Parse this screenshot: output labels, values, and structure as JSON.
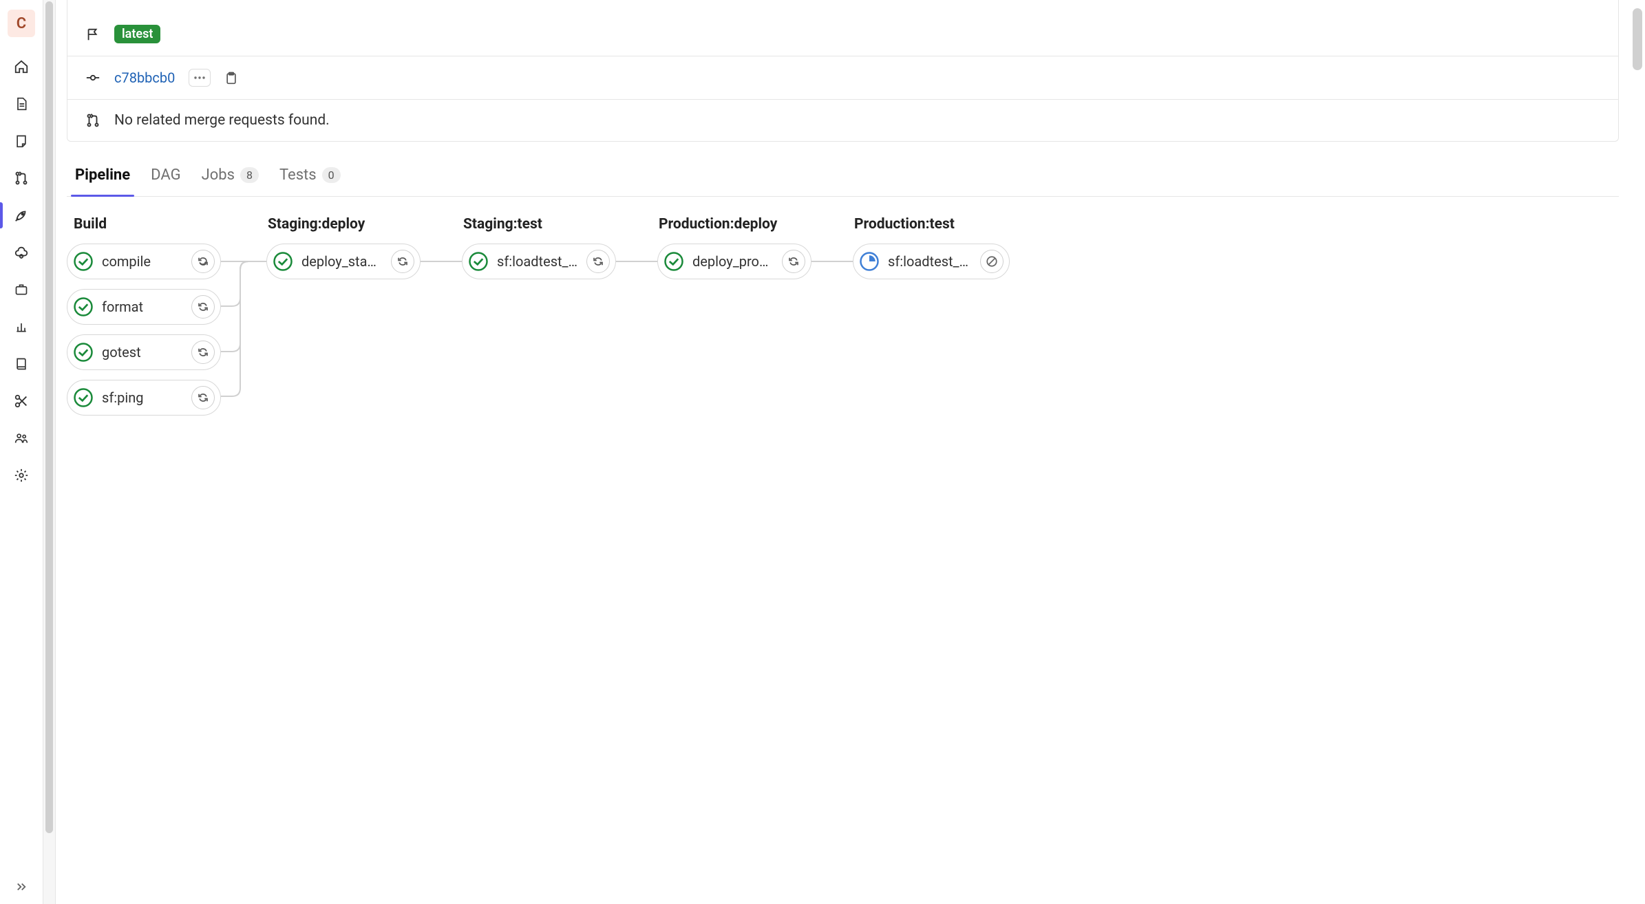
{
  "sidebar": {
    "avatar_letter": "C"
  },
  "header": {
    "badge": "latest",
    "commit_sha": "c78bbcb0",
    "mr_text": "No related merge requests found."
  },
  "tabs": {
    "pipeline": "Pipeline",
    "dag": "DAG",
    "jobs_label": "Jobs",
    "jobs_count": "8",
    "tests_label": "Tests",
    "tests_count": "0"
  },
  "stages": {
    "build": "Build",
    "staging_deploy": "Staging:deploy",
    "staging_test": "Staging:test",
    "production_deploy": "Production:deploy",
    "production_test": "Production:test"
  },
  "jobs": {
    "compile": "compile",
    "format": "format",
    "gotest": "gotest",
    "sfping": "sf:ping",
    "deploy_staging": "deploy_staging",
    "sf_loadtest_sta": "sf:loadtest_sta...",
    "deploy_product": "deploy_product...",
    "sf_loadtest_pro": "sf:loadtest_pro..."
  }
}
